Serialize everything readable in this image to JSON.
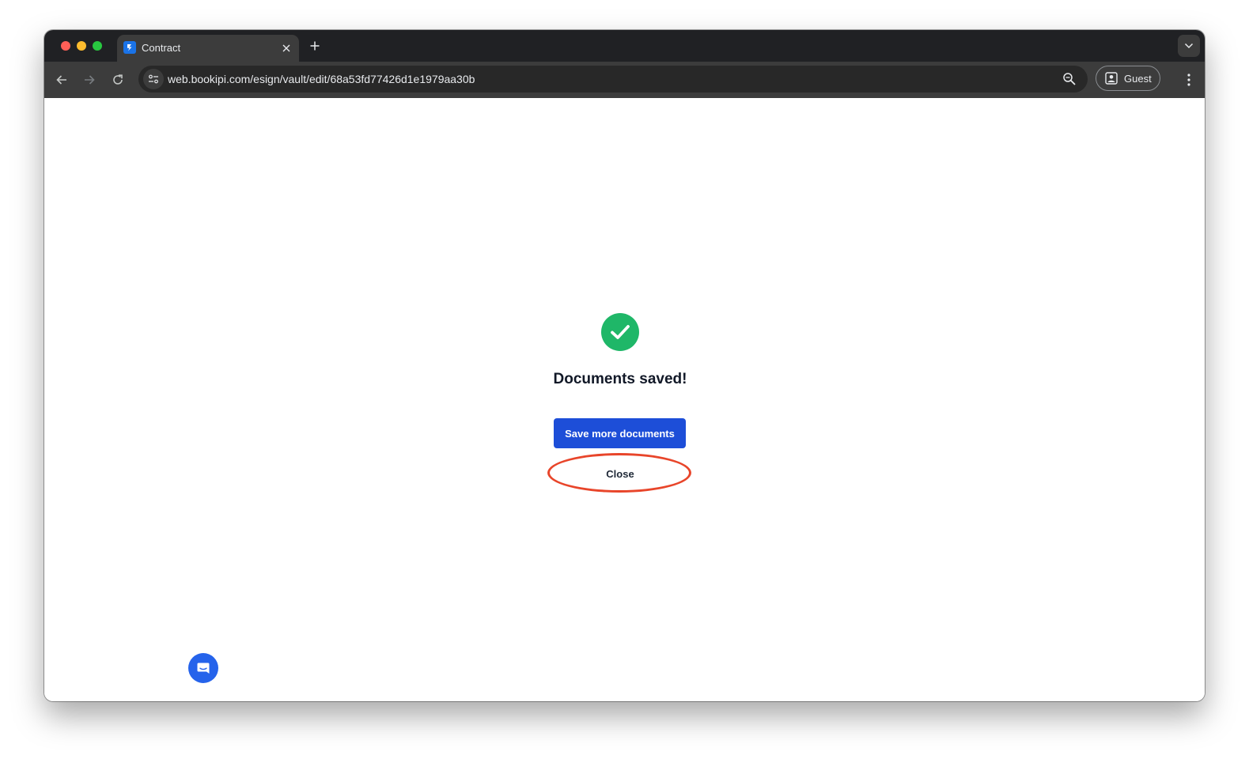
{
  "browser": {
    "tab": {
      "title": "Contract",
      "favicon": "bookipi-logo-icon"
    },
    "url": "web.bookipi.com/esign/vault/edit/68a53fd77426d1e1979aa30b",
    "profile_label": "Guest"
  },
  "dialog": {
    "icon": "check-circle-icon",
    "title": "Documents saved!",
    "primary_button": "Save more documents",
    "secondary_button": "Close"
  },
  "colors": {
    "success": "#1fb768",
    "primary": "#1d4ed8",
    "annotation": "#e8452a",
    "chat": "#2563eb"
  }
}
